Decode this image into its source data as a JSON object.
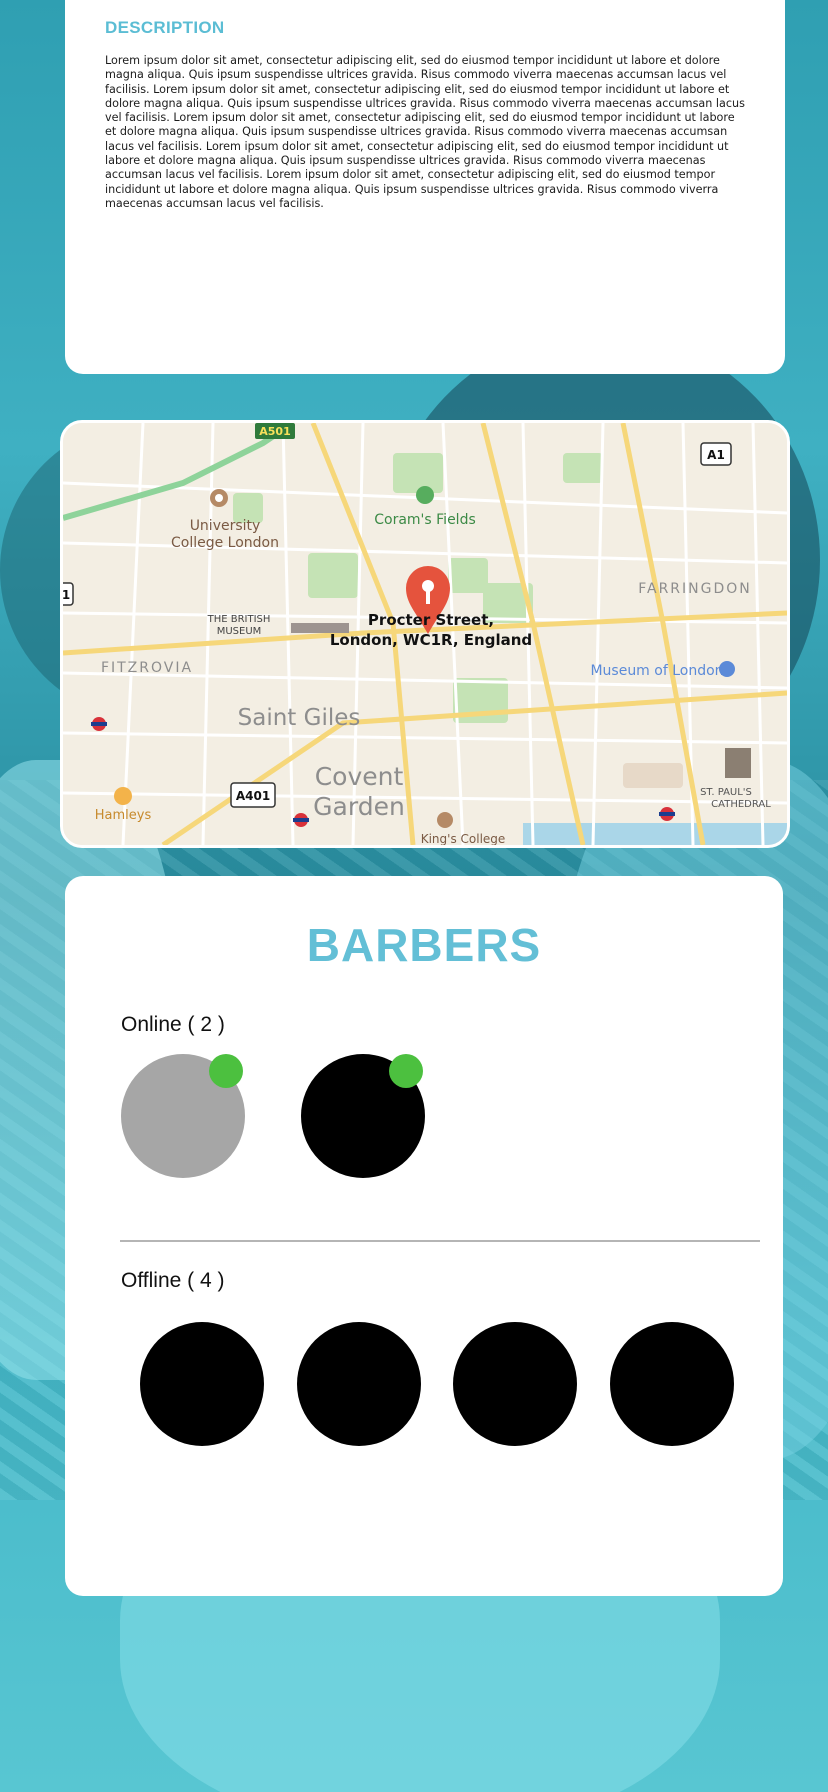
{
  "description": {
    "title": "DESCRIPTION",
    "body": "Lorem ipsum dolor sit amet, consectetur adipiscing elit, sed do eiusmod tempor incididunt ut labore et dolore magna aliqua. Quis ipsum suspendisse ultrices gravida. Risus commodo viverra maecenas accumsan lacus vel facilisis. Lorem ipsum dolor sit amet, consectetur adipiscing elit, sed do eiusmod tempor incididunt ut labore et dolore magna aliqua. Quis ipsum suspendisse ultrices gravida. Risus commodo viverra maecenas accumsan lacus vel facilisis. Lorem ipsum dolor sit amet, consectetur adipiscing elit, sed do eiusmod tempor incididunt ut labore et dolore magna aliqua. Quis ipsum suspendisse ultrices gravida. Risus commodo viverra maecenas accumsan lacus vel facilisis. Lorem ipsum dolor sit amet, consectetur adipiscing elit, sed do eiusmod tempor incididunt ut labore et dolore magna aliqua. Quis ipsum suspendisse ultrices gravida. Risus commodo viverra maecenas accumsan lacus vel facilisis. Lorem ipsum dolor sit amet, consectetur adipiscing elit, sed do eiusmod tempor incididunt ut labore et dolore magna aliqua. Quis ipsum suspendisse ultrices gravida. Risus commodo viverra maecenas accumsan lacus vel facilisis."
  },
  "map": {
    "pin_address_line1": "Procter Street,",
    "pin_address_line2": "London, WC1R, England",
    "labels": {
      "university": "University",
      "college_london": "College London",
      "corams_fields": "Coram's Fields",
      "farringdon": "FARRINGDON",
      "british_museum_1": "THE BRITISH",
      "british_museum_2": "MUSEUM",
      "fitzrovia": "FITZROVIA",
      "museum_of_london": "Museum of London",
      "saint_giles": "Saint Giles",
      "covent": "Covent",
      "garden": "Garden",
      "hamleys": "Hamleys",
      "st_pauls_1": "ST. PAUL'S",
      "st_pauls_2": "CATHEDRAL",
      "kings_college": "King's College",
      "road_a1": "A1",
      "road_a401": "A401",
      "road_a501": "A501",
      "road_1": "1"
    }
  },
  "barbers": {
    "title": "BARBERS",
    "online_label": "Online ( 2 )",
    "offline_label": "Offline ( 4 )",
    "online": [
      {
        "color": "#a6a6a6",
        "status_color": "#4cc03f"
      },
      {
        "color": "#000000",
        "status_color": "#4cc03f"
      }
    ],
    "offline": [
      {
        "color": "#000000"
      },
      {
        "color": "#000000"
      },
      {
        "color": "#000000"
      },
      {
        "color": "#000000"
      }
    ]
  },
  "colors": {
    "accent": "#5bbdd4",
    "online": "#4cc03f",
    "pin": "#e5533d"
  }
}
